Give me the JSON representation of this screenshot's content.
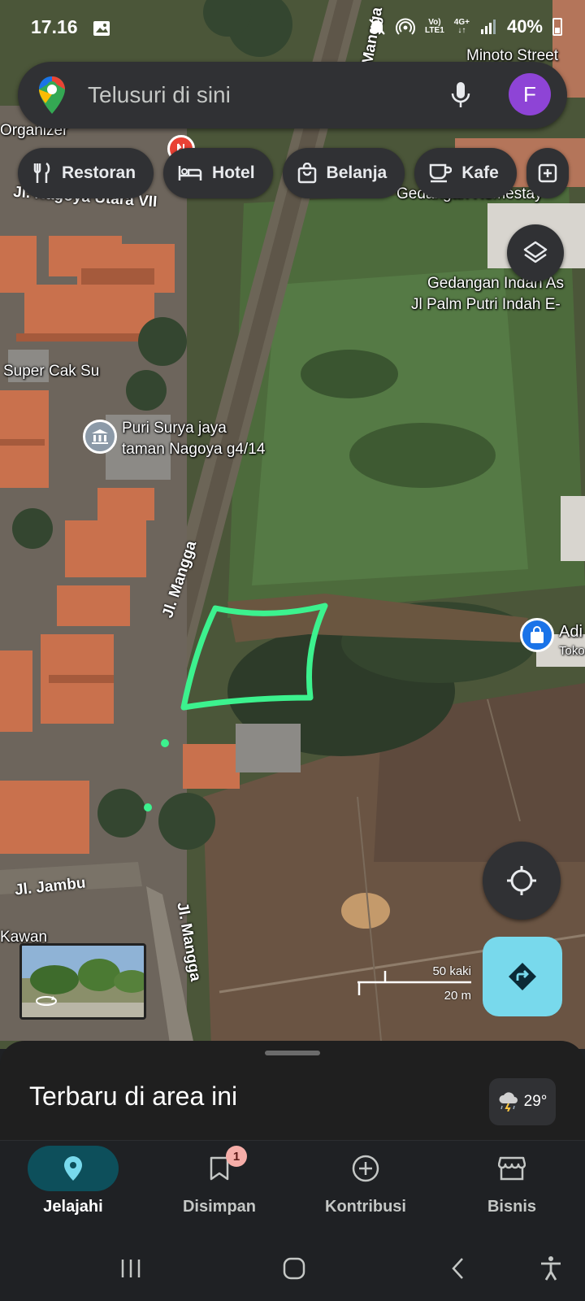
{
  "status_bar": {
    "time": "17.16",
    "battery": "40%",
    "network_top": "Vo)",
    "network_bottom": "LTE1",
    "network_type": "4G+",
    "icons": [
      "gallery-icon",
      "mute-icon",
      "hotspot-icon",
      "signal-icon",
      "battery-icon"
    ]
  },
  "search": {
    "placeholder": "Telusuri di sini",
    "avatar_letter": "F"
  },
  "chips": [
    {
      "label": "Restoran",
      "icon": "fork-knife-icon"
    },
    {
      "label": "Hotel",
      "icon": "bed-icon"
    },
    {
      "label": "Belanja",
      "icon": "shopping-bag-icon"
    },
    {
      "label": "Kafe",
      "icon": "coffee-cup-icon"
    }
  ],
  "map_labels": {
    "minoto": "Minoto Street",
    "organizer": "Organizer",
    "nagoya_utara": "Jl. Nagoya Utara VII",
    "gedangan_homestay": "Gedangan Homestay",
    "gedangan_indah": "Gedangan Indah As",
    "palm_putri": "Jl Palm Putri Indah E-",
    "super_cak": "Super Cak Su",
    "puri_surya_1": "Puri Surya jaya",
    "puri_surya_2": "taman Nagoya g4/14",
    "mangga_top": "Jl. Mangga",
    "mangga_bottom": "Jl. Mangga",
    "jambu": "Jl. Jambu",
    "kawan": "Kawan",
    "adi": "Adi",
    "toko": "Toko",
    "manga_top": "Mangga"
  },
  "scale": {
    "imperial": "50 kaki",
    "metric": "20 m"
  },
  "sheet": {
    "title": "Terbaru di area ini",
    "temperature": "29°"
  },
  "nav": [
    {
      "label": "Jelajahi",
      "icon": "location-pin-icon",
      "active": true
    },
    {
      "label": "Disimpan",
      "icon": "bookmark-icon",
      "badge": "1"
    },
    {
      "label": "Kontribusi",
      "icon": "add-circle-icon"
    },
    {
      "label": "Bisnis",
      "icon": "storefront-icon"
    }
  ],
  "colors": {
    "accent": "#78d9ec",
    "active_nav": "#0d4f5b",
    "drawing": "#3cf28e",
    "avatar": "#8e44d6"
  }
}
